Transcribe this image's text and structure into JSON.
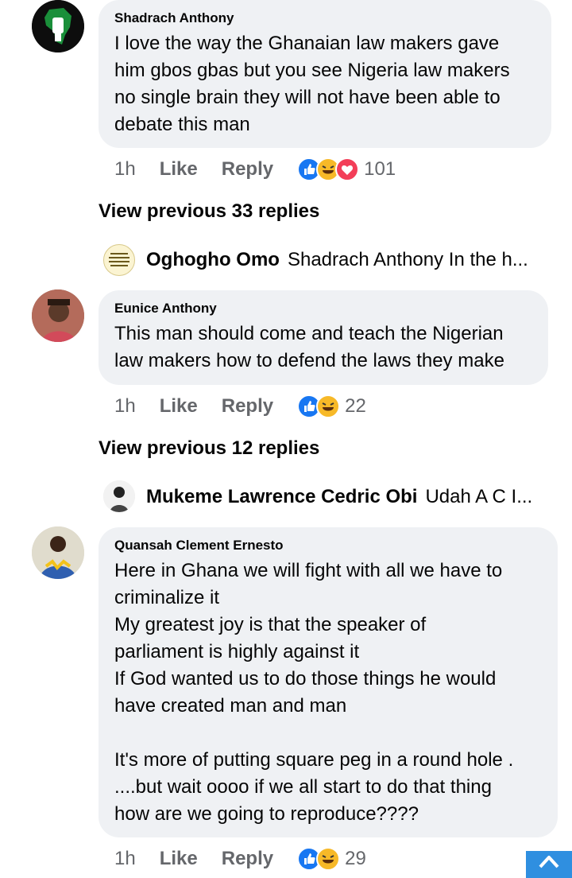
{
  "comments": [
    {
      "author": "Shadrach Anthony",
      "text": "I love the way the Ghanaian law makers gave\nhim gbos gbas but you see Nigeria law makers\nno single brain they will not have been able to\ndebate this man",
      "time": "1h",
      "like_label": "Like",
      "reply_label": "Reply",
      "reaction_icons": [
        "like-icon",
        "haha-icon",
        "love-icon"
      ],
      "reaction_count": "101",
      "view_previous": "View previous 33 replies",
      "latest_reply": {
        "author": "Oghogho Omo",
        "text": "Shadrach Anthony In the h..."
      }
    },
    {
      "author": "Eunice Anthony",
      "text": "This man should come and teach the Nigerian\nlaw makers how to defend the laws they make",
      "time": "1h",
      "like_label": "Like",
      "reply_label": "Reply",
      "reaction_icons": [
        "like-icon",
        "haha-icon"
      ],
      "reaction_count": "22",
      "view_previous": "View previous 12 replies",
      "latest_reply": {
        "author": "Mukeme Lawrence Cedric Obi",
        "text": "Udah A C I..."
      }
    },
    {
      "author": "Quansah Clement Ernesto",
      "text": "Here in Ghana we will fight with all we have to\ncriminalize it\nMy greatest joy is that the speaker of\nparliament is highly against it\nIf God wanted us to do those things he would\nhave created man and man\n\nIt's more of putting square peg in a round hole .\n....but wait oooo if we all start to do that thing\nhow are we going to reproduce????",
      "time": "1h",
      "like_label": "Like",
      "reply_label": "Reply",
      "reaction_icons": [
        "like-icon",
        "haha-icon"
      ],
      "reaction_count": "29"
    }
  ],
  "colors": {
    "bubble": "#eff1f4",
    "like_blue": "#1877f2",
    "haha_yellow": "#f7b928",
    "love_red": "#f33e58",
    "meta_gray": "#65676b",
    "scroll_button": "#2f8fe0"
  },
  "scroll_button_icon": "chevron-up-icon"
}
